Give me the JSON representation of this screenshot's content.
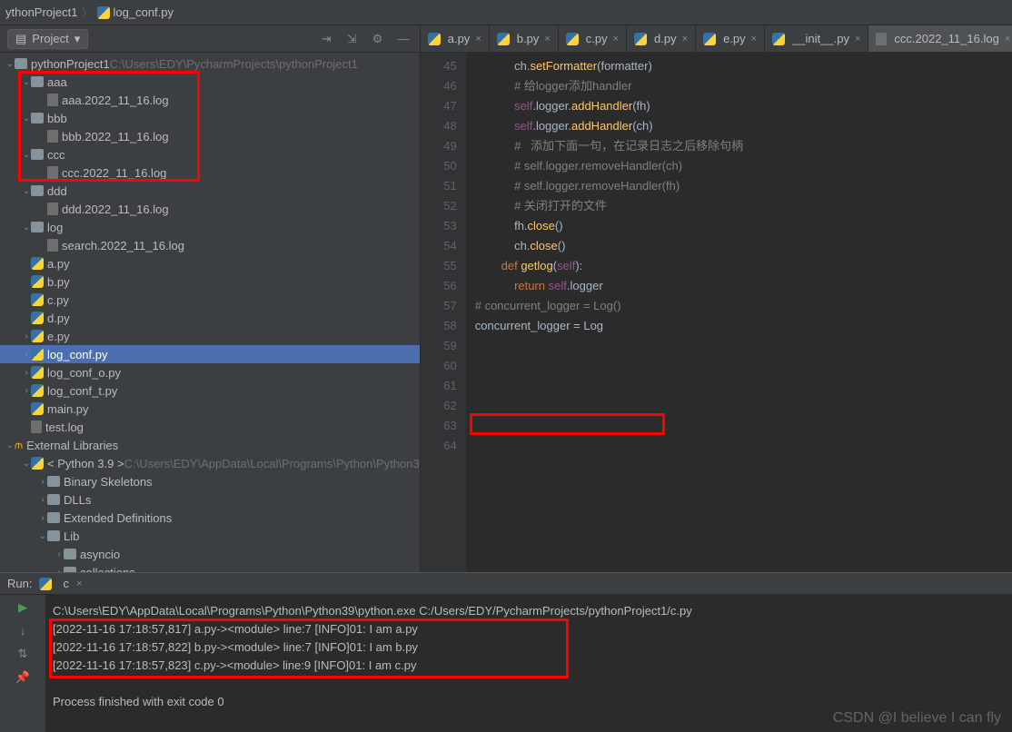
{
  "breadcrumb": {
    "project": "ythonProject1",
    "file": "log_conf.py"
  },
  "sidebar": {
    "label": "Project",
    "root": {
      "name": "pythonProject1",
      "path": "C:\\Users\\EDY\\PycharmProjects\\pythonProject1"
    },
    "items": [
      {
        "indent": 1,
        "arrow": "v",
        "icon": "fold",
        "name": "aaa"
      },
      {
        "indent": 2,
        "arrow": "",
        "icon": "log",
        "name": "aaa.2022_11_16.log"
      },
      {
        "indent": 1,
        "arrow": "v",
        "icon": "fold",
        "name": "bbb"
      },
      {
        "indent": 2,
        "arrow": "",
        "icon": "log",
        "name": "bbb.2022_11_16.log"
      },
      {
        "indent": 1,
        "arrow": "v",
        "icon": "fold",
        "name": "ccc"
      },
      {
        "indent": 2,
        "arrow": "",
        "icon": "log",
        "name": "ccc.2022_11_16.log"
      },
      {
        "indent": 1,
        "arrow": "v",
        "icon": "fold",
        "name": "ddd"
      },
      {
        "indent": 2,
        "arrow": "",
        "icon": "log",
        "name": "ddd.2022_11_16.log"
      },
      {
        "indent": 1,
        "arrow": "v",
        "icon": "fold",
        "name": "log"
      },
      {
        "indent": 2,
        "arrow": "",
        "icon": "log",
        "name": "search.2022_11_16.log"
      },
      {
        "indent": 1,
        "arrow": "",
        "icon": "py",
        "name": "a.py"
      },
      {
        "indent": 1,
        "arrow": "",
        "icon": "py",
        "name": "b.py"
      },
      {
        "indent": 1,
        "arrow": "",
        "icon": "py",
        "name": "c.py"
      },
      {
        "indent": 1,
        "arrow": "",
        "icon": "py",
        "name": "d.py"
      },
      {
        "indent": 1,
        "arrow": ">",
        "icon": "py",
        "name": "e.py"
      },
      {
        "indent": 1,
        "arrow": ">",
        "icon": "py",
        "name": "log_conf.py",
        "sel": true
      },
      {
        "indent": 1,
        "arrow": ">",
        "icon": "py",
        "name": "log_conf_o.py"
      },
      {
        "indent": 1,
        "arrow": ">",
        "icon": "py",
        "name": "log_conf_t.py"
      },
      {
        "indent": 1,
        "arrow": "",
        "icon": "py",
        "name": "main.py"
      },
      {
        "indent": 1,
        "arrow": "",
        "icon": "log",
        "name": "test.log"
      }
    ],
    "ext_label": "External Libraries",
    "python": {
      "name": "< Python 3.9 >",
      "path": "C:\\Users\\EDY\\AppData\\Local\\Programs\\Python\\Python3"
    },
    "ext_items": [
      {
        "indent": 2,
        "arrow": ">",
        "name": "Binary Skeletons"
      },
      {
        "indent": 2,
        "arrow": ">",
        "name": "DLLs"
      },
      {
        "indent": 2,
        "arrow": ">",
        "name": "Extended Definitions"
      },
      {
        "indent": 2,
        "arrow": "v",
        "name": "Lib"
      },
      {
        "indent": 3,
        "arrow": ">",
        "name": "asyncio"
      },
      {
        "indent": 3,
        "arrow": ">",
        "name": "collections"
      }
    ]
  },
  "tabs": [
    {
      "name": "a.py"
    },
    {
      "name": "b.py"
    },
    {
      "name": "c.py"
    },
    {
      "name": "d.py"
    },
    {
      "name": "e.py"
    },
    {
      "name": "__init__.py"
    },
    {
      "name": "ccc.2022_11_16.log",
      "act": true
    }
  ],
  "code": {
    "start": 45,
    "lines": [
      {
        "n": 45,
        "ind": 3,
        "seg": [
          [
            "id",
            "ch"
          ],
          [
            "id",
            "."
          ],
          [
            "fn",
            "setFormatter"
          ],
          [
            "id",
            "(formatter)"
          ]
        ]
      },
      {
        "n": 46,
        "ind": 0,
        "seg": []
      },
      {
        "n": 47,
        "ind": 3,
        "seg": [
          [
            "com",
            "# 给logger添加handler"
          ]
        ]
      },
      {
        "n": 48,
        "ind": 3,
        "seg": [
          [
            "self",
            "self"
          ],
          [
            "id",
            "."
          ],
          [
            "id",
            "logger"
          ],
          [
            "id",
            "."
          ],
          [
            "fn",
            "addHandler"
          ],
          [
            "id",
            "(fh)"
          ]
        ]
      },
      {
        "n": 49,
        "ind": 3,
        "seg": [
          [
            "self",
            "self"
          ],
          [
            "id",
            "."
          ],
          [
            "id",
            "logger"
          ],
          [
            "id",
            "."
          ],
          [
            "fn",
            "addHandler"
          ],
          [
            "id",
            "(ch)"
          ]
        ]
      },
      {
        "n": 50,
        "ind": 0,
        "seg": []
      },
      {
        "n": 51,
        "ind": 3,
        "seg": [
          [
            "com",
            "#   添加下面一句，在记录日志之后移除句柄"
          ]
        ]
      },
      {
        "n": 52,
        "ind": 3,
        "seg": [
          [
            "com",
            "# self.logger.removeHandler(ch)"
          ]
        ]
      },
      {
        "n": 53,
        "ind": 3,
        "seg": [
          [
            "com",
            "# self.logger.removeHandler(fh)"
          ]
        ]
      },
      {
        "n": 54,
        "ind": 3,
        "seg": [
          [
            "com",
            "# 关闭打开的文件"
          ]
        ]
      },
      {
        "n": 55,
        "ind": 3,
        "seg": [
          [
            "id",
            "fh."
          ],
          [
            "fn",
            "close"
          ],
          [
            "id",
            "()"
          ]
        ]
      },
      {
        "n": 56,
        "ind": 3,
        "seg": [
          [
            "id",
            "ch."
          ],
          [
            "fn",
            "close"
          ],
          [
            "id",
            "()"
          ]
        ]
      },
      {
        "n": 57,
        "ind": 0,
        "seg": []
      },
      {
        "n": 58,
        "ind": 2,
        "seg": [
          [
            "kw",
            "def "
          ],
          [
            "fn",
            "getlog"
          ],
          [
            "id",
            "("
          ],
          [
            "self",
            "self"
          ],
          [
            "id",
            "):"
          ]
        ]
      },
      {
        "n": 59,
        "ind": 3,
        "seg": [
          [
            "kw",
            "return "
          ],
          [
            "self",
            "self"
          ],
          [
            "id",
            "."
          ],
          [
            "id",
            "logger"
          ]
        ]
      },
      {
        "n": 60,
        "ind": 0,
        "seg": []
      },
      {
        "n": 61,
        "ind": 0,
        "seg": []
      },
      {
        "n": 62,
        "ind": 0,
        "seg": [
          [
            "com",
            "# concurrent_logger = Log()"
          ]
        ]
      },
      {
        "n": 63,
        "ind": 0,
        "seg": [
          [
            "id",
            "concurrent_logger = Log"
          ]
        ]
      },
      {
        "n": 64,
        "ind": 0,
        "seg": []
      }
    ]
  },
  "run": {
    "label": "Run:",
    "config": "c",
    "cmd": "C:\\Users\\EDY\\AppData\\Local\\Programs\\Python\\Python39\\python.exe C:/Users/EDY/PycharmProjects/pythonProject1/c.py",
    "out": [
      "[2022-11-16 17:18:57,817] a.py-><module> line:7 [INFO]01: I am a.py",
      "[2022-11-16 17:18:57,822] b.py-><module> line:7 [INFO]01: I am b.py",
      "[2022-11-16 17:18:57,823] c.py-><module> line:9 [INFO]01: I am c.py"
    ],
    "exit": "Process finished with exit code 0"
  },
  "watermark": "CSDN @I believe I can fly"
}
